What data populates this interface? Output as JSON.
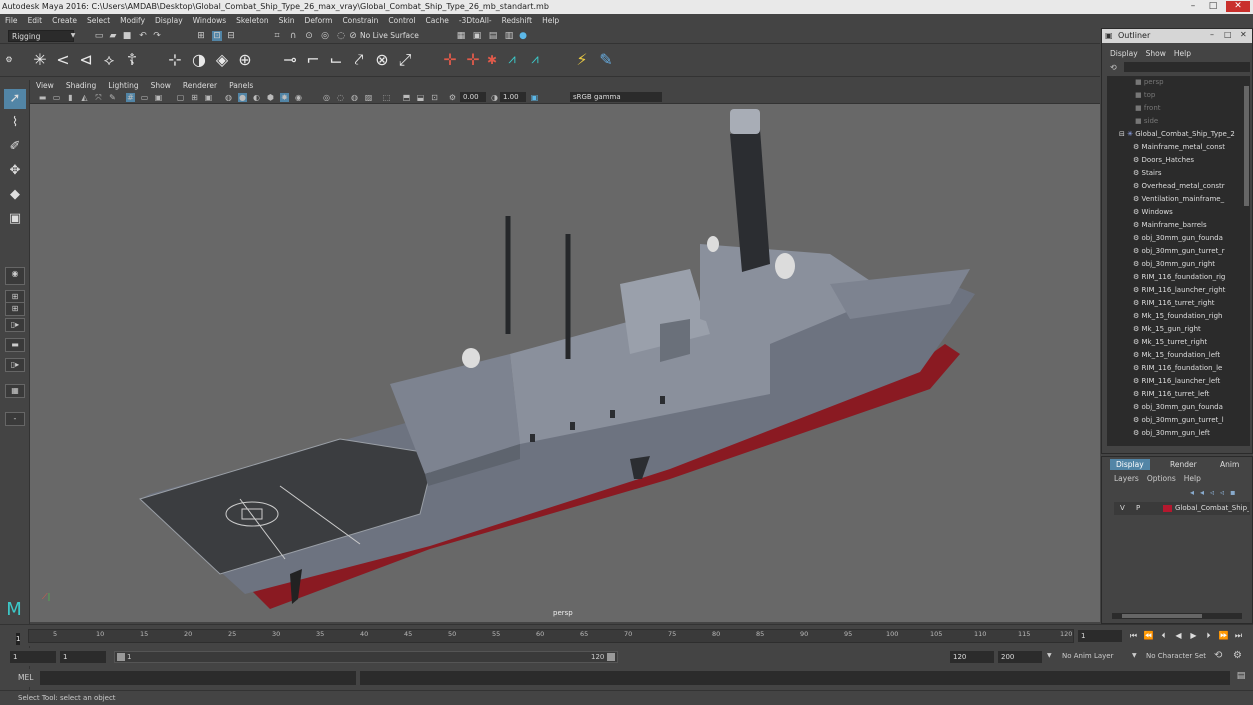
{
  "app": {
    "window_title": "Autodesk Maya 2016: C:\\Users\\AMDAB\\Desktop\\Global_Combat_Ship_Type_26_max_vray\\Global_Combat_Ship_Type_26_mb_standart.mb"
  },
  "menus": [
    "File",
    "Edit",
    "Create",
    "Select",
    "Modify",
    "Display",
    "Windows",
    "Skeleton",
    "Skin",
    "Deform",
    "Constrain",
    "Control",
    "Cache",
    "-3DtoAll-",
    "Redshift",
    "Help"
  ],
  "status_line": {
    "menu_set": "Rigging",
    "live_surface": "No Live Surface"
  },
  "panel_menus": [
    "View",
    "Shading",
    "Lighting",
    "Show",
    "Renderer",
    "Panels"
  ],
  "panel_toolbar": {
    "exposure": "0.00",
    "gamma": "1.00",
    "color_space": "sRGB gamma"
  },
  "viewport": {
    "camera": "persp"
  },
  "outliner": {
    "title": "Outliner",
    "menus": [
      "Display",
      "Show",
      "Help"
    ],
    "cameras": [
      "persp",
      "top",
      "front",
      "side"
    ],
    "group": "Global_Combat_Ship_Type_2",
    "items": [
      "Mainframe_metal_const",
      "Doors_Hatches",
      "Stairs",
      "Overhead_metal_constr",
      "Ventilation_mainframe_",
      "Windows",
      "Mainframe_barrels",
      "obj_30mm_gun_founda",
      "obj_30mm_gun_turret_r",
      "obj_30mm_gun_right",
      "RIM_116_foundation_rig",
      "RIM_116_launcher_right",
      "RIM_116_turret_right",
      "Mk_15_foundation_righ",
      "Mk_15_gun_right",
      "Mk_15_turret_right",
      "Mk_15_foundation_left",
      "RIM_116_foundation_le",
      "RIM_116_launcher_left",
      "RIM_116_turret_left",
      "obj_30mm_gun_founda",
      "obj_30mm_gun_turret_l",
      "obj_30mm_gun_left"
    ]
  },
  "channel_box": {
    "tabs": [
      "Display",
      "Render",
      "Anim"
    ],
    "menus": [
      "Layers",
      "Options",
      "Help"
    ],
    "layer": {
      "visible": "V",
      "playback": "P",
      "name": "Global_Combat_Ship_T",
      "color": "#b4182e"
    }
  },
  "timeline": {
    "ticks": [
      "5",
      "10",
      "15",
      "20",
      "25",
      "30",
      "35",
      "40",
      "45",
      "50",
      "55",
      "60",
      "65",
      "70",
      "75",
      "80",
      "85",
      "90",
      "95",
      "100",
      "105",
      "110",
      "115",
      "120"
    ],
    "current_frame_marker": "1",
    "current_frame": "1"
  },
  "range": {
    "start": "1",
    "playback_start": "1",
    "slider_start": "1",
    "slider_end": "120",
    "playback_end": "120",
    "end": "200",
    "anim_layer": "No Anim Layer",
    "character_set": "No Character Set"
  },
  "command_line": {
    "label": "MEL"
  },
  "help_line": {
    "text": "Select Tool: select an object"
  }
}
